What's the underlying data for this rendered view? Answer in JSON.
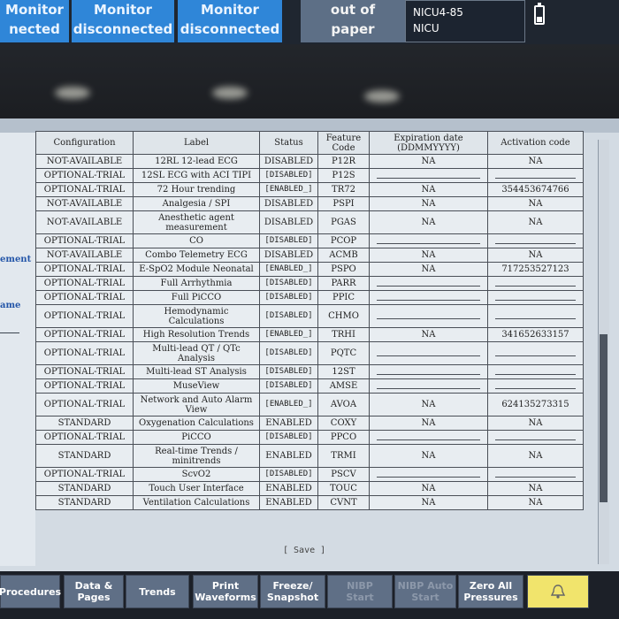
{
  "topbar": {
    "btn1": [
      "Monitor",
      "nected"
    ],
    "btn2": [
      "Monitor",
      "disconnected"
    ],
    "btn3": [
      "Monitor",
      "disconnected"
    ],
    "paper": [
      "out of",
      "paper"
    ],
    "bed": [
      "NICU4-85",
      "NICU"
    ]
  },
  "sidebar": {
    "label1": "ement",
    "label2": "ame"
  },
  "table": {
    "headers": {
      "config": "Configuration",
      "label": "Label",
      "status": "Status",
      "code": "Feature Code",
      "expiry": "Expiration date (DDMMYYYY)",
      "activation": "Activation code"
    },
    "rows": [
      {
        "config": "NOT-AVAILABLE",
        "label": "12RL 12-lead ECG",
        "status": "DISABLED",
        "code": "P12R",
        "expiry": "NA",
        "activation": "NA"
      },
      {
        "config": "OPTIONAL-TRIAL",
        "label": "12SL ECG with ACI TIPI",
        "status": "[DISABLED]",
        "code": "P12S",
        "expiry": "",
        "activation": ""
      },
      {
        "config": "OPTIONAL-TRIAL",
        "label": "72 Hour trending",
        "status": "[ENABLED_]",
        "code": "TR72",
        "expiry": "NA",
        "activation": "354453674766"
      },
      {
        "config": "NOT-AVAILABLE",
        "label": "Analgesia / SPI",
        "status": "DISABLED",
        "code": "PSPI",
        "expiry": "NA",
        "activation": "NA"
      },
      {
        "config": "NOT-AVAILABLE",
        "label": "Anesthetic agent measurement",
        "status": "DISABLED",
        "code": "PGAS",
        "expiry": "NA",
        "activation": "NA"
      },
      {
        "config": "OPTIONAL-TRIAL",
        "label": "CO",
        "status": "[DISABLED]",
        "code": "PCOP",
        "expiry": "",
        "activation": ""
      },
      {
        "config": "NOT-AVAILABLE",
        "label": "Combo Telemetry ECG",
        "status": "DISABLED",
        "code": "ACMB",
        "expiry": "NA",
        "activation": "NA"
      },
      {
        "config": "OPTIONAL-TRIAL",
        "label": "E-SpO2 Module Neonatal",
        "status": "[ENABLED_]",
        "code": "PSPO",
        "expiry": "NA",
        "activation": "717253527123"
      },
      {
        "config": "OPTIONAL-TRIAL",
        "label": "Full Arrhythmia",
        "status": "[DISABLED]",
        "code": "PARR",
        "expiry": "",
        "activation": ""
      },
      {
        "config": "OPTIONAL-TRIAL",
        "label": "Full PiCCO",
        "status": "[DISABLED]",
        "code": "PPIC",
        "expiry": "",
        "activation": ""
      },
      {
        "config": "OPTIONAL-TRIAL",
        "label": "Hemodynamic Calculations",
        "status": "[DISABLED]",
        "code": "CHMO",
        "expiry": "",
        "activation": ""
      },
      {
        "config": "OPTIONAL-TRIAL",
        "label": "High Resolution Trends",
        "status": "[ENABLED_]",
        "code": "TRHI",
        "expiry": "NA",
        "activation": "341652633157"
      },
      {
        "config": "OPTIONAL-TRIAL",
        "label": "Multi-lead QT / QTc Analysis",
        "status": "[DISABLED]",
        "code": "PQTC",
        "expiry": "",
        "activation": ""
      },
      {
        "config": "OPTIONAL-TRIAL",
        "label": "Multi-lead ST Analysis",
        "status": "[DISABLED]",
        "code": "12ST",
        "expiry": "",
        "activation": ""
      },
      {
        "config": "OPTIONAL-TRIAL",
        "label": "MuseView",
        "status": "[DISABLED]",
        "code": "AMSE",
        "expiry": "",
        "activation": ""
      },
      {
        "config": "OPTIONAL-TRIAL",
        "label": "Network and Auto Alarm View",
        "status": "[ENABLED_]",
        "code": "AVOA",
        "expiry": "NA",
        "activation": "624135273315"
      },
      {
        "config": "STANDARD",
        "label": "Oxygenation Calculations",
        "status": "ENABLED",
        "code": "COXY",
        "expiry": "NA",
        "activation": "NA"
      },
      {
        "config": "OPTIONAL-TRIAL",
        "label": "PiCCO",
        "status": "[DISABLED]",
        "code": "PPCO",
        "expiry": "",
        "activation": ""
      },
      {
        "config": "STANDARD",
        "label": "Real-time Trends / minitrends",
        "status": "ENABLED",
        "code": "TRMI",
        "expiry": "NA",
        "activation": "NA"
      },
      {
        "config": "OPTIONAL-TRIAL",
        "label": "ScvO2",
        "status": "[DISABLED]",
        "code": "PSCV",
        "expiry": "",
        "activation": ""
      },
      {
        "config": "STANDARD",
        "label": "Touch User Interface",
        "status": "ENABLED",
        "code": "TOUC",
        "expiry": "NA",
        "activation": "NA"
      },
      {
        "config": "STANDARD",
        "label": "Ventilation Calculations",
        "status": "ENABLED",
        "code": "CVNT",
        "expiry": "NA",
        "activation": "NA"
      }
    ]
  },
  "save_label": "[ Save ]",
  "bottom": {
    "procedures": "Procedures",
    "data_pages": [
      "Data &",
      "Pages"
    ],
    "trends": "Trends",
    "print": [
      "Print",
      "Waveforms"
    ],
    "freeze": [
      "Freeze/",
      "Snapshot"
    ],
    "nibp_start": [
      "NIBP",
      "Start"
    ],
    "nibp_auto": [
      "NIBP Auto",
      "Start"
    ],
    "zero_all": [
      "Zero All",
      "Pressures"
    ],
    "alarm_icon": "alarm-bell-icon"
  },
  "colors": {
    "top_button": "#2f86d8",
    "window_bg": "#d3dbe3",
    "bottom_button": "#5f6f86",
    "alarm_button": "#f1e46c"
  }
}
